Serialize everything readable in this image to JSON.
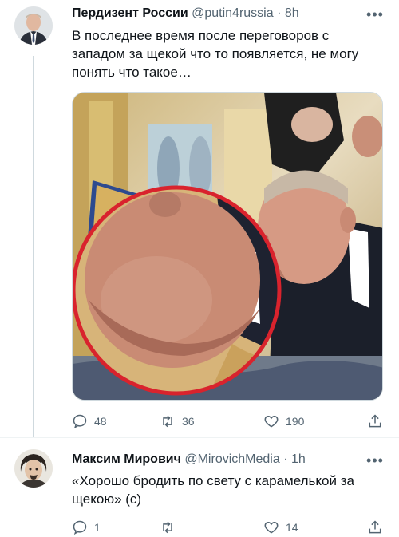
{
  "tweets": [
    {
      "author": {
        "name": "Пердизент России",
        "handle": "@putin4russia",
        "separator": "·",
        "time": "8h"
      },
      "text": "В последнее время после переговоров с западом за щекой что то появляется, не могу понять что такое…",
      "more": "•••",
      "stats": {
        "replies": "48",
        "retweets": "36",
        "likes": "190"
      },
      "media_icon": "photo-of-men-at-icon-with-zoomed-circle-icon"
    },
    {
      "author": {
        "name": "Максим Мирович",
        "handle": "@MirovichMedia",
        "separator": "·",
        "time": "1h"
      },
      "text": "«Хорошо бродить по свету с карамелькой за щекою» (с)",
      "more": "•••",
      "stats": {
        "replies": "1",
        "retweets": "",
        "likes": "14"
      }
    }
  ],
  "colors": {
    "text": "#0f1419",
    "muted": "#536471",
    "border": "#cfd9de",
    "zoom_ring": "#d9232d"
  }
}
